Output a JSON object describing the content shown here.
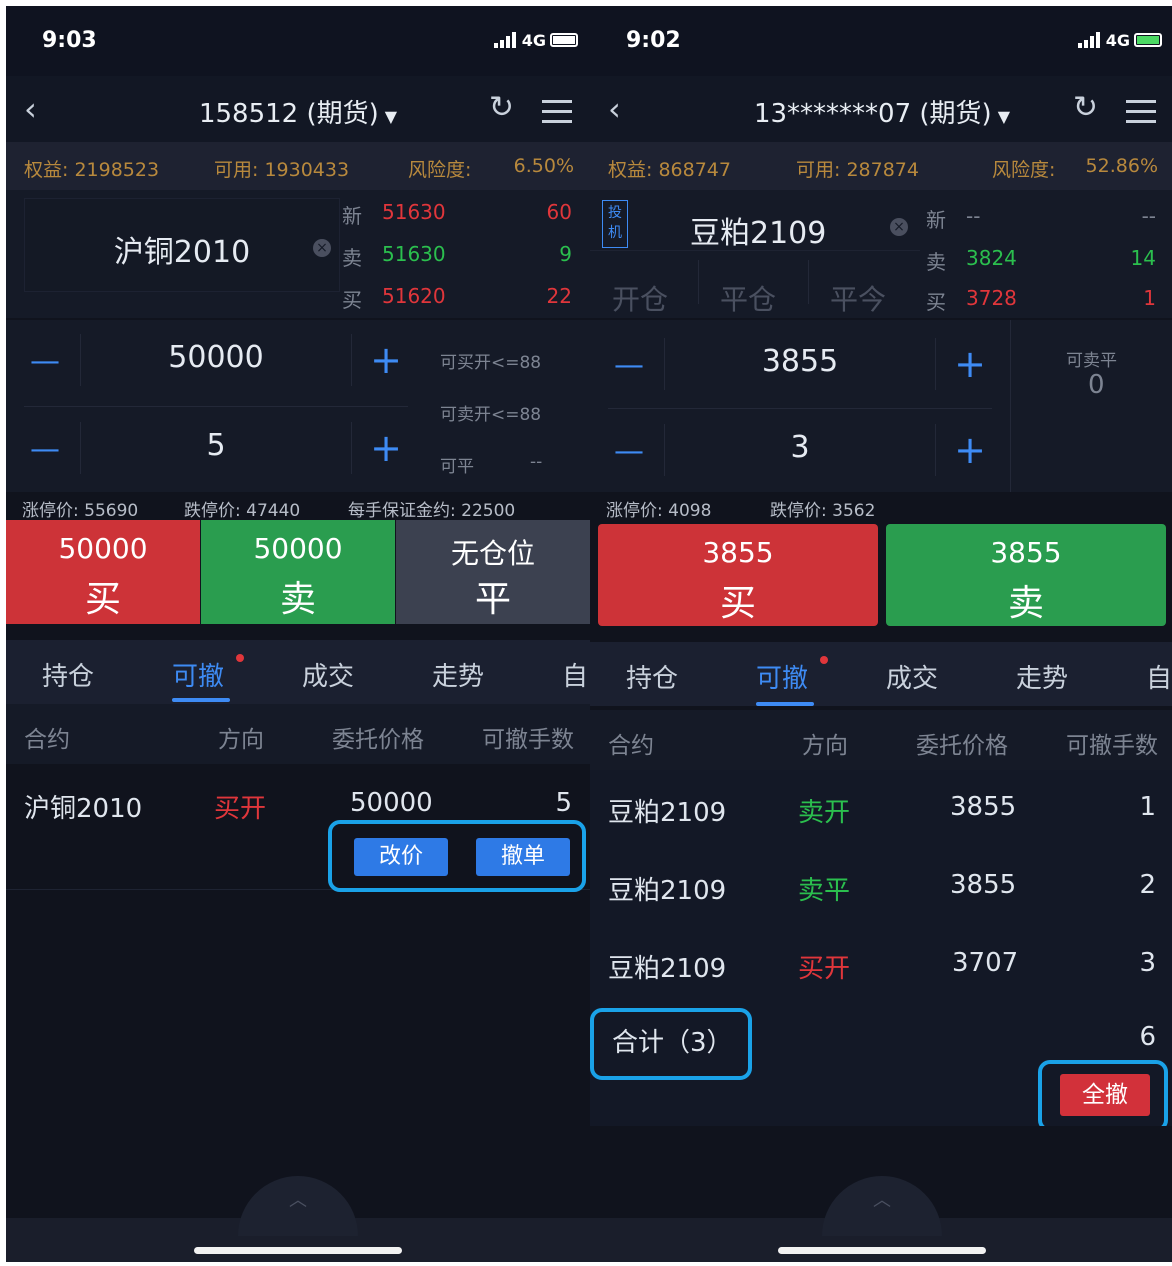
{
  "left": {
    "status": {
      "time": "9:03",
      "network": "4G"
    },
    "nav": {
      "back_icon": "‹",
      "title": "158512 (期货)",
      "caret": "▼",
      "refresh_icon": "↻"
    },
    "account": {
      "equity_label": "权益:",
      "equity": "2198523",
      "available_label": "可用:",
      "available": "1930433",
      "risk_label": "风险度:",
      "risk": "6.50%"
    },
    "instrument": {
      "name": "沪铜2010"
    },
    "depth": [
      {
        "label": "新",
        "price": "51630",
        "volume": "60"
      },
      {
        "label": "卖",
        "price": "51630",
        "volume": "9"
      },
      {
        "label": "买",
        "price": "51620",
        "volume": "22"
      }
    ],
    "price_stepper": {
      "value": "50000"
    },
    "qty_stepper": {
      "value": "5"
    },
    "side_info": {
      "can_buy_open": "可买开<=88",
      "can_sell_open": "可卖开<=88",
      "can_close_label": "可平",
      "can_close_value": "--"
    },
    "limits": {
      "upper": "涨停价: 55690",
      "lower": "跌停价: 47440",
      "margin": "每手保证金约: 22500"
    },
    "buttons": {
      "buy": {
        "price": "50000",
        "action": "买"
      },
      "sell": {
        "price": "50000",
        "action": "卖"
      },
      "close": {
        "price": "无仓位",
        "action": "平"
      }
    },
    "tabs": [
      "持仓",
      "可撤",
      "成交",
      "走势",
      "自"
    ],
    "table_headers": [
      "合约",
      "方向",
      "委托价格",
      "可撤手数"
    ],
    "rows": [
      {
        "contract": "沪铜2010",
        "direction": "买开",
        "price": "50000",
        "qty": "5"
      }
    ],
    "row_actions": {
      "modify": "改价",
      "cancel": "撤单"
    },
    "pull_icon": "︿"
  },
  "right": {
    "status": {
      "time": "9:02",
      "network": "4G"
    },
    "nav": {
      "back_icon": "‹",
      "title": "13*******07 (期货)",
      "caret": "▼",
      "refresh_icon": "↻"
    },
    "account": {
      "equity_label": "权益:",
      "equity": "868747",
      "available_label": "可用:",
      "available": "287874",
      "risk_label": "风险度:",
      "risk": "52.86%"
    },
    "instrument": {
      "badge": "投机",
      "name": "豆粕2109"
    },
    "mode_tabs": [
      "开仓",
      "平仓",
      "平今"
    ],
    "depth": [
      {
        "label": "新",
        "price": "--",
        "volume": "--"
      },
      {
        "label": "卖",
        "price": "3824",
        "volume": "14"
      },
      {
        "label": "买",
        "price": "3728",
        "volume": "1"
      }
    ],
    "price_stepper": {
      "value": "3855"
    },
    "qty_stepper": {
      "value": "3"
    },
    "side_info": {
      "can_sell_close_label": "可卖平",
      "can_sell_close_value": "0"
    },
    "limits": {
      "upper": "涨停价: 4098",
      "lower": "跌停价: 3562"
    },
    "buttons": {
      "buy": {
        "price": "3855",
        "action": "买"
      },
      "sell": {
        "price": "3855",
        "action": "卖"
      }
    },
    "tabs": [
      "持仓",
      "可撤",
      "成交",
      "走势",
      "自"
    ],
    "table_headers": [
      "合约",
      "方向",
      "委托价格",
      "可撤手数"
    ],
    "rows": [
      {
        "contract": "豆粕2109",
        "direction": "卖开",
        "price": "3855",
        "qty": "1"
      },
      {
        "contract": "豆粕2109",
        "direction": "卖平",
        "price": "3855",
        "qty": "2"
      },
      {
        "contract": "豆粕2109",
        "direction": "买开",
        "price": "3707",
        "qty": "3"
      }
    ],
    "total": {
      "label": "合计（3）",
      "qty": "6"
    },
    "cancel_all": "全撤",
    "pull_icon": "︿"
  },
  "colors": {
    "red": "#e0363b",
    "green": "#2bbf4e",
    "blue": "#3e8bf4",
    "gold": "#b8893d",
    "highlight": "#1aa2e8"
  }
}
